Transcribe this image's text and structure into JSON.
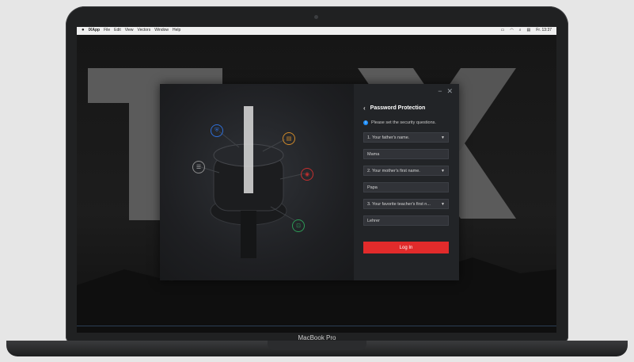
{
  "menubar": {
    "app": "IXApp",
    "items": [
      "File",
      "Edit",
      "View",
      "Vectors",
      "Window",
      "Help"
    ],
    "clock": "Fr. 13:37"
  },
  "dialog": {
    "title": "Password Protection",
    "info_text": "Please set the security questions.",
    "q1": {
      "label": "1. Your father's name."
    },
    "a1": {
      "value": "Mama"
    },
    "q2": {
      "label": "2. Your mother's first name."
    },
    "a2": {
      "value": "Papa"
    },
    "q3": {
      "label": "3. Your favorite teacher's first n..."
    },
    "a3": {
      "value": "Lehrer"
    },
    "login_label": "Log In",
    "minimize": "−",
    "close": "✕"
  },
  "device": {
    "brand": "MacBook Pro"
  },
  "colors": {
    "accent_red": "#e22b2b",
    "info_blue": "#1e90ff"
  }
}
